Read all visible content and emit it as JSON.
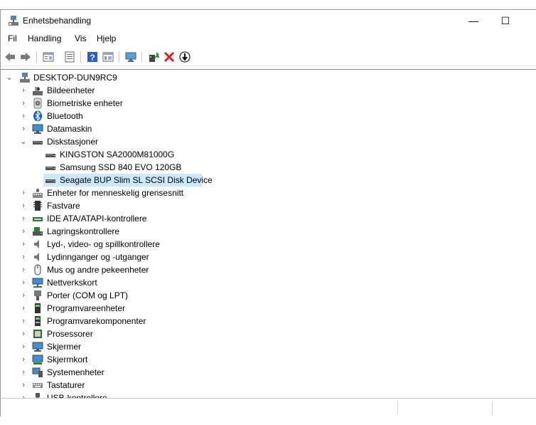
{
  "window": {
    "title": "Enhetsbehandling",
    "controls": {
      "minimize": "—",
      "maximize": "☐"
    }
  },
  "menu": [
    "Fil",
    "Handling",
    "Vis",
    "Hjelp"
  ],
  "toolbar_icons": [
    "back-arrow-icon",
    "forward-arrow-icon",
    "properties-icon",
    "show-hidden-icon",
    "help-icon",
    "view-icon",
    "monitor-icon",
    "update-driver-icon",
    "uninstall-icon",
    "disable-icon"
  ],
  "tree": {
    "root": "DESKTOP-DUN9RC9",
    "categories": [
      {
        "label": "Bildeenheter",
        "icon": "camera-icon",
        "expanded": false
      },
      {
        "label": "Biometriske enheter",
        "icon": "fingerprint-icon",
        "expanded": false
      },
      {
        "label": "Bluetooth",
        "icon": "bluetooth-icon",
        "expanded": false
      },
      {
        "label": "Datamaskin",
        "icon": "computer-icon",
        "expanded": false
      },
      {
        "label": "Diskstasjoner",
        "icon": "disk-drive-icon",
        "expanded": true,
        "children": [
          "KINGSTON SA2000M81000G",
          "Samsung SSD 840 EVO 120GB",
          "Seagate BUP Slim SL SCSI Disk Device"
        ],
        "selected_child": "Seagate BUP Slim SL SCSI Disk Device"
      },
      {
        "label": "Enheter for menneskelig grensesnitt",
        "icon": "hid-icon",
        "expanded": false
      },
      {
        "label": "Fastvare",
        "icon": "firmware-icon",
        "expanded": false
      },
      {
        "label": "IDE ATA/ATAPI-kontrollere",
        "icon": "ide-controller-icon",
        "expanded": false
      },
      {
        "label": "Lagringskontrollere",
        "icon": "storage-controller-icon",
        "expanded": false
      },
      {
        "label": "Lyd-, video- og spillkontrollere",
        "icon": "speaker-icon",
        "expanded": false
      },
      {
        "label": "Lydinnganger og -utganger",
        "icon": "speaker-icon",
        "expanded": false
      },
      {
        "label": "Mus og andre pekeenheter",
        "icon": "mouse-icon",
        "expanded": false
      },
      {
        "label": "Nettverkskort",
        "icon": "network-icon",
        "expanded": false
      },
      {
        "label": "Porter (COM og LPT)",
        "icon": "port-icon",
        "expanded": false
      },
      {
        "label": "Programvareenheter",
        "icon": "software-device-icon",
        "expanded": false
      },
      {
        "label": "Programvarekomponenter",
        "icon": "software-component-icon",
        "expanded": false
      },
      {
        "label": "Prosessorer",
        "icon": "processor-icon",
        "expanded": false
      },
      {
        "label": "Skjermer",
        "icon": "monitor-icon",
        "expanded": false
      },
      {
        "label": "Skjermkort",
        "icon": "display-adapter-icon",
        "expanded": false
      },
      {
        "label": "Systemenheter",
        "icon": "system-device-icon",
        "expanded": false
      },
      {
        "label": "Tastaturer",
        "icon": "keyboard-icon",
        "expanded": false
      },
      {
        "label": "USB-kontrollere",
        "icon": "usb-icon",
        "expanded": false
      }
    ]
  },
  "colors": {
    "selection": "#cce8ff",
    "accent": "#0078d7"
  }
}
